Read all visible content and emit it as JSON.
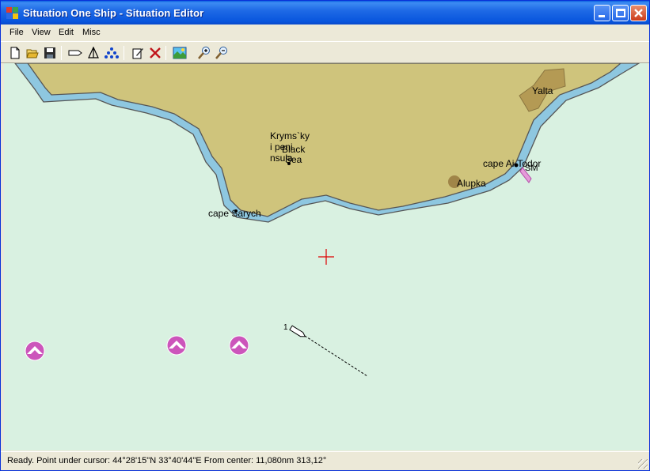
{
  "window": {
    "title": "Situation One Ship - Situation Editor",
    "title_bar_color": "#0a5fe0"
  },
  "menu": {
    "items": [
      "File",
      "View",
      "Edit",
      "Misc"
    ]
  },
  "toolbar": {
    "buttons": [
      "new-icon",
      "open-icon",
      "save-icon",
      "route-icon",
      "ship-icon",
      "sounding-icon",
      "edit-icon",
      "delete-icon",
      "chart-icon",
      "zoom-in-icon",
      "zoom-out-icon"
    ]
  },
  "map": {
    "colors": {
      "sea": "#d9f1e1",
      "shallow": "#8ec7e0",
      "land": "#cfc47c",
      "town": "#b49a54",
      "marker": "#cc55bb",
      "cursor": "#dd0000"
    },
    "labels": {
      "peninsula": "Kryms`ky\ni peni\nnsula",
      "sea": "Black\nSea",
      "yalta": "Yalta",
      "cape_ai_todor": "cape Ai-Todor",
      "alupka": "Alupka",
      "cape_sarych": "cape Sarych",
      "beacon": "SM",
      "ship_number": "1"
    }
  },
  "status": {
    "text": "Ready. Point under cursor: 44°28'15\"N 33°40'44\"E From center: 11,080nm 313,12°"
  }
}
